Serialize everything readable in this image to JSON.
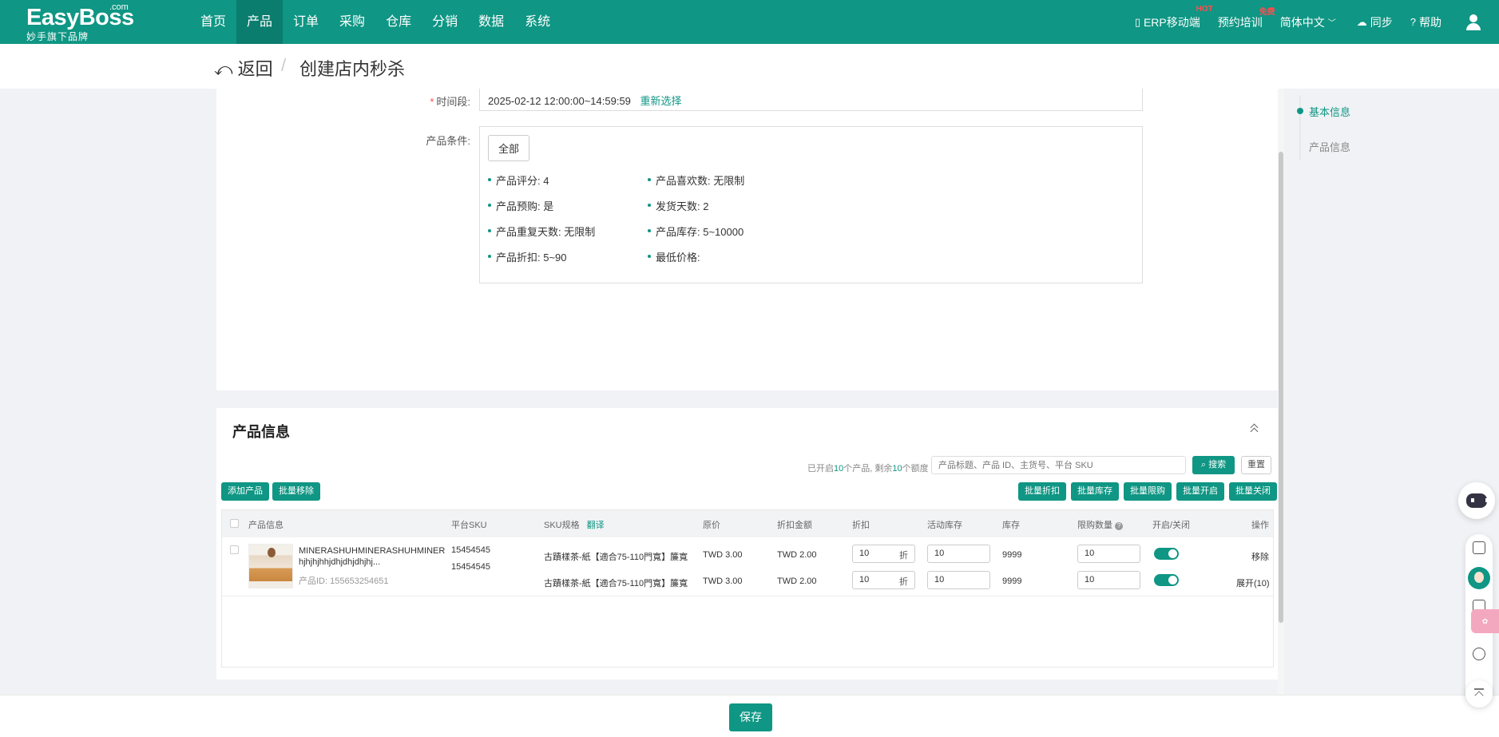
{
  "brand": {
    "name": "EasyBoss",
    "suffix": ".com",
    "tagline": "妙手旗下品牌"
  },
  "nav": {
    "items": [
      "首页",
      "产品",
      "订单",
      "采购",
      "仓库",
      "分销",
      "数据",
      "系统"
    ],
    "active_index": 1
  },
  "topbar_right": {
    "mobile": "ERP移动端",
    "mobile_badge": "HOT",
    "training": "预约培训",
    "training_badge": "免费",
    "language": "简体中文",
    "sync": "同步",
    "help": "帮助"
  },
  "subheader": {
    "back_label": "返回",
    "separator": "/",
    "title": "创建店内秒杀"
  },
  "basic": {
    "time_label": "时间段:",
    "time_value": "2025-02-12 12:00:00~14:59:59",
    "reselect": "重新选择",
    "cond_label": "产品条件:",
    "all_button": "全部",
    "conditions": [
      "产品评分:  4",
      "产品喜欢数:  无限制",
      "产品预购:  是",
      "发货天数:  2",
      "产品重复天数:  无限制",
      "产品库存:  5~10000",
      "产品折扣:  5~90",
      "最低价格:"
    ]
  },
  "anchor": {
    "items": [
      "基本信息",
      "产品信息"
    ],
    "active_index": 0
  },
  "product_section": {
    "title": "产品信息",
    "quota_prefix": "已开启",
    "quota_count": "10",
    "quota_mid": "个产品, 剩余",
    "quota_left": "10",
    "quota_suffix": "个额度",
    "search_placeholder": "产品标题、产品 ID、主货号、平台 SKU",
    "search_button": "搜索",
    "reset_button": "重置",
    "left_buttons": [
      "添加产品",
      "批量移除"
    ],
    "right_buttons": [
      "批量折扣",
      "批量库存",
      "批量限购",
      "批量开启",
      "批量关闭"
    ],
    "columns": [
      "产品信息",
      "平台SKU",
      "SKU规格",
      "原价",
      "折扣金额",
      "折扣",
      "活动库存",
      "库存",
      "限购数量",
      "开启/关闭",
      "操作"
    ],
    "sku_spec_toggle": "翻译",
    "product": {
      "name_line1": "MINERASHUHMINERASHUHMINER",
      "name_line2": "hjhjhjhhjdhjdhjdhjhj...",
      "id_label": "产品ID:  155653254651",
      "actions": {
        "remove": "移除",
        "expand": "展开(10)"
      },
      "rows": [
        {
          "sku": "15454545",
          "spec": "古蹟樣茶-紙【適合75-110門寬】簾寬",
          "price": "TWD 3.00",
          "discount_amount": "TWD 2.00",
          "discount": "10",
          "discount_unit": "折",
          "activity_stock": "10",
          "stock": "9999",
          "limit": "10",
          "enabled": true
        },
        {
          "sku": "15454545",
          "spec": "古蹟樣茶-紙【適合75-110門寬】簾寬",
          "price": "TWD 3.00",
          "discount_amount": "TWD 2.00",
          "discount": "10",
          "discount_unit": "折",
          "activity_stock": "10",
          "stock": "9999",
          "limit": "10",
          "enabled": true
        }
      ]
    }
  },
  "footer": {
    "save_label": "保存"
  },
  "colors": {
    "brand": "#0f9684",
    "brand_dark": "#0a7d6e",
    "hot": "#ff4d4f"
  }
}
